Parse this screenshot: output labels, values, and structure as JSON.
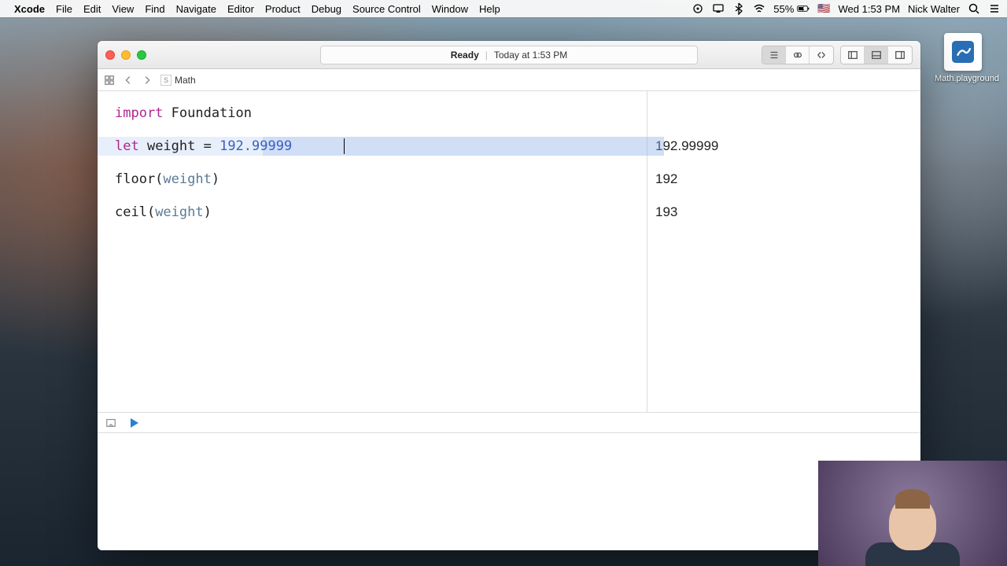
{
  "menubar": {
    "app": "Xcode",
    "items": [
      "File",
      "Edit",
      "View",
      "Find",
      "Navigate",
      "Editor",
      "Product",
      "Debug",
      "Source Control",
      "Window",
      "Help"
    ],
    "battery": "55%",
    "clock": "Wed 1:53 PM",
    "user": "Nick Walter"
  },
  "desktop": {
    "file_name": "Math.playground"
  },
  "window": {
    "status_primary": "Ready",
    "status_secondary": "Today at 1:53 PM",
    "jump_path": "Math"
  },
  "code": {
    "line1_kw": "import",
    "line1_mod": " Foundation",
    "line2_kw": "let",
    "line2_rest": " weight = ",
    "line2_num": "192.99999",
    "line3_fn": "floor(",
    "line3_arg": "weight",
    "line3_close": ")",
    "line4_fn": "ceil(",
    "line4_arg": "weight",
    "line4_close": ")"
  },
  "results": {
    "r1": "192.99999",
    "r2": "192",
    "r3": "193"
  }
}
